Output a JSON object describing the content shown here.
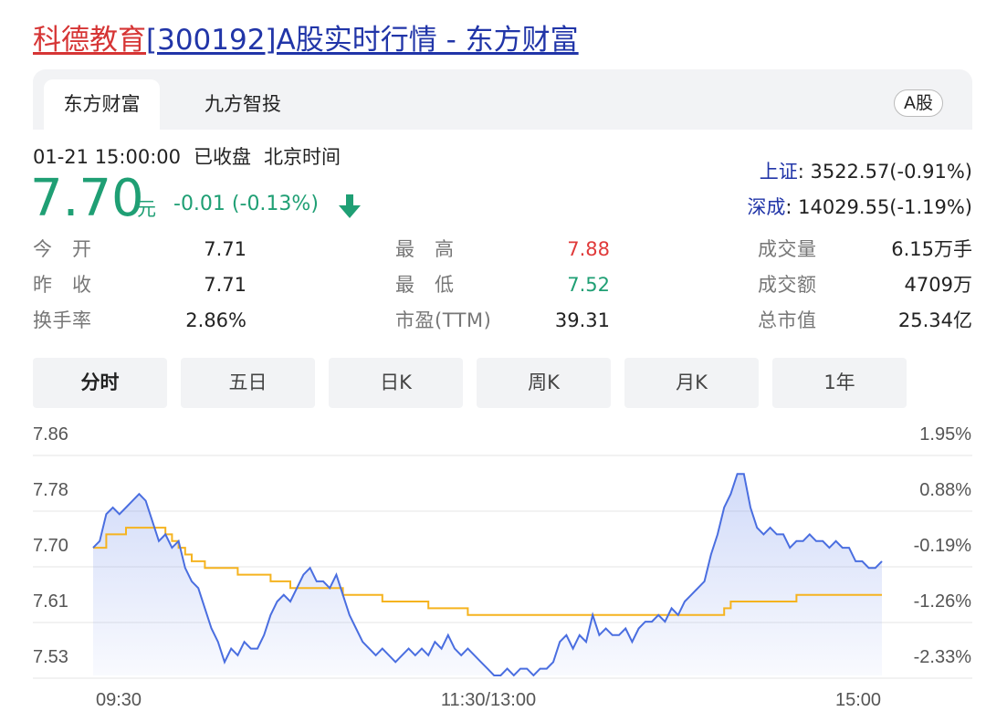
{
  "page": {
    "title_part1": "科德教育",
    "title_part2": "[300192]A股实时行情 - 东方财富"
  },
  "tabs": {
    "items": [
      {
        "label": "东方财富",
        "active": true
      },
      {
        "label": "九方智投",
        "active": false
      }
    ],
    "market_badge": "A股"
  },
  "quote": {
    "datetime": "01-21 15:00:00",
    "status": "已收盘",
    "timezone": "北京时间",
    "price": "7.70",
    "price_unit": "元",
    "change": "-0.01 (-0.13%)",
    "direction_icon": "arrow-down-icon",
    "down_color": "#1f9f74",
    "up_color": "#e03a3a"
  },
  "indices": [
    {
      "name": "上证",
      "value": ": 3522.57(-0.91%)"
    },
    {
      "name": "深成",
      "value": ": 14029.55(-1.19%)"
    }
  ],
  "stats": [
    {
      "label": "今　开",
      "value": "7.71"
    },
    {
      "label": "昨　收",
      "value": "7.71"
    },
    {
      "label": "换手率",
      "value": "2.86%"
    },
    {
      "label": "最　高",
      "value": "7.88"
    },
    {
      "label": "最　低",
      "value": "7.52"
    },
    {
      "label": "市盈(TTM)",
      "value": "39.31"
    },
    {
      "label": "成交量",
      "value": "6.15万手"
    },
    {
      "label": "成交额",
      "value": "4709万"
    },
    {
      "label": "总市值",
      "value": "25.34亿"
    }
  ],
  "periods": [
    {
      "label": "分时",
      "active": true
    },
    {
      "label": "五日",
      "active": false
    },
    {
      "label": "日K",
      "active": false
    },
    {
      "label": "周K",
      "active": false
    },
    {
      "label": "月K",
      "active": false
    },
    {
      "label": "1年",
      "active": false
    }
  ],
  "chart_data": {
    "type": "line",
    "title": "",
    "y_ticks_left": [
      "7.86",
      "7.78",
      "7.70",
      "7.61",
      "7.53"
    ],
    "y_ticks_right": [
      "1.95%",
      "0.88%",
      "-0.19%",
      "-1.26%",
      "-2.33%"
    ],
    "x_ticks": [
      "09:30",
      "11:30/13:00",
      "15:00"
    ],
    "ylim": [
      7.51,
      7.87
    ],
    "x_range_minutes": [
      0,
      240
    ],
    "prev_close": 7.71,
    "series": [
      {
        "role": "price",
        "color": "#4a6ee0",
        "points": [
          [
            0,
            7.7
          ],
          [
            2,
            7.71
          ],
          [
            4,
            7.75
          ],
          [
            6,
            7.76
          ],
          [
            8,
            7.75
          ],
          [
            10,
            7.76
          ],
          [
            12,
            7.77
          ],
          [
            14,
            7.78
          ],
          [
            16,
            7.77
          ],
          [
            18,
            7.74
          ],
          [
            20,
            7.71
          ],
          [
            22,
            7.72
          ],
          [
            24,
            7.7
          ],
          [
            26,
            7.71
          ],
          [
            28,
            7.67
          ],
          [
            30,
            7.65
          ],
          [
            32,
            7.64
          ],
          [
            34,
            7.61
          ],
          [
            36,
            7.58
          ],
          [
            38,
            7.56
          ],
          [
            40,
            7.53
          ],
          [
            42,
            7.55
          ],
          [
            44,
            7.54
          ],
          [
            46,
            7.56
          ],
          [
            48,
            7.55
          ],
          [
            50,
            7.55
          ],
          [
            52,
            7.57
          ],
          [
            54,
            7.6
          ],
          [
            56,
            7.62
          ],
          [
            58,
            7.63
          ],
          [
            60,
            7.62
          ],
          [
            62,
            7.64
          ],
          [
            64,
            7.66
          ],
          [
            66,
            7.67
          ],
          [
            68,
            7.65
          ],
          [
            70,
            7.65
          ],
          [
            72,
            7.64
          ],
          [
            74,
            7.66
          ],
          [
            76,
            7.63
          ],
          [
            78,
            7.6
          ],
          [
            80,
            7.58
          ],
          [
            82,
            7.56
          ],
          [
            84,
            7.55
          ],
          [
            86,
            7.54
          ],
          [
            88,
            7.55
          ],
          [
            90,
            7.54
          ],
          [
            92,
            7.53
          ],
          [
            94,
            7.54
          ],
          [
            96,
            7.55
          ],
          [
            98,
            7.54
          ],
          [
            100,
            7.55
          ],
          [
            102,
            7.54
          ],
          [
            104,
            7.56
          ],
          [
            106,
            7.55
          ],
          [
            108,
            7.57
          ],
          [
            110,
            7.55
          ],
          [
            112,
            7.54
          ],
          [
            114,
            7.55
          ],
          [
            116,
            7.54
          ],
          [
            118,
            7.53
          ],
          [
            120,
            7.52
          ],
          [
            122,
            7.51
          ],
          [
            124,
            7.51
          ],
          [
            126,
            7.52
          ],
          [
            128,
            7.51
          ],
          [
            130,
            7.52
          ],
          [
            132,
            7.52
          ],
          [
            134,
            7.51
          ],
          [
            136,
            7.52
          ],
          [
            138,
            7.52
          ],
          [
            140,
            7.53
          ],
          [
            142,
            7.56
          ],
          [
            144,
            7.57
          ],
          [
            146,
            7.55
          ],
          [
            148,
            7.57
          ],
          [
            150,
            7.56
          ],
          [
            152,
            7.6
          ],
          [
            154,
            7.57
          ],
          [
            156,
            7.58
          ],
          [
            158,
            7.57
          ],
          [
            160,
            7.57
          ],
          [
            162,
            7.58
          ],
          [
            164,
            7.56
          ],
          [
            166,
            7.58
          ],
          [
            168,
            7.59
          ],
          [
            170,
            7.59
          ],
          [
            172,
            7.6
          ],
          [
            174,
            7.59
          ],
          [
            176,
            7.61
          ],
          [
            178,
            7.6
          ],
          [
            180,
            7.62
          ],
          [
            182,
            7.63
          ],
          [
            184,
            7.64
          ],
          [
            186,
            7.65
          ],
          [
            188,
            7.69
          ],
          [
            190,
            7.72
          ],
          [
            192,
            7.76
          ],
          [
            194,
            7.78
          ],
          [
            196,
            7.81
          ],
          [
            198,
            7.81
          ],
          [
            200,
            7.76
          ],
          [
            202,
            7.73
          ],
          [
            204,
            7.72
          ],
          [
            206,
            7.73
          ],
          [
            208,
            7.72
          ],
          [
            210,
            7.72
          ],
          [
            212,
            7.7
          ],
          [
            214,
            7.71
          ],
          [
            216,
            7.71
          ],
          [
            218,
            7.72
          ],
          [
            220,
            7.71
          ],
          [
            222,
            7.71
          ],
          [
            224,
            7.7
          ],
          [
            226,
            7.71
          ],
          [
            228,
            7.7
          ],
          [
            230,
            7.7
          ],
          [
            232,
            7.68
          ],
          [
            234,
            7.68
          ],
          [
            236,
            7.67
          ],
          [
            238,
            7.67
          ],
          [
            240,
            7.68
          ]
        ]
      },
      {
        "role": "average",
        "color": "#f5b31f",
        "points": [
          [
            0,
            7.7
          ],
          [
            4,
            7.72
          ],
          [
            6,
            7.72
          ],
          [
            10,
            7.73
          ],
          [
            16,
            7.73
          ],
          [
            20,
            7.73
          ],
          [
            22,
            7.72
          ],
          [
            24,
            7.71
          ],
          [
            26,
            7.7
          ],
          [
            28,
            7.69
          ],
          [
            30,
            7.68
          ],
          [
            32,
            7.68
          ],
          [
            34,
            7.67
          ],
          [
            40,
            7.67
          ],
          [
            44,
            7.66
          ],
          [
            48,
            7.66
          ],
          [
            52,
            7.66
          ],
          [
            54,
            7.65
          ],
          [
            56,
            7.65
          ],
          [
            58,
            7.65
          ],
          [
            60,
            7.64
          ],
          [
            64,
            7.64
          ],
          [
            72,
            7.64
          ],
          [
            74,
            7.64
          ],
          [
            76,
            7.63
          ],
          [
            78,
            7.63
          ],
          [
            84,
            7.63
          ],
          [
            86,
            7.63
          ],
          [
            88,
            7.62
          ],
          [
            92,
            7.62
          ],
          [
            94,
            7.62
          ],
          [
            96,
            7.62
          ],
          [
            98,
            7.62
          ],
          [
            100,
            7.62
          ],
          [
            102,
            7.61
          ],
          [
            106,
            7.61
          ],
          [
            110,
            7.61
          ],
          [
            112,
            7.61
          ],
          [
            114,
            7.6
          ],
          [
            118,
            7.6
          ],
          [
            122,
            7.6
          ],
          [
            126,
            7.6
          ],
          [
            130,
            7.6
          ],
          [
            134,
            7.6
          ],
          [
            138,
            7.6
          ],
          [
            142,
            7.6
          ],
          [
            146,
            7.6
          ],
          [
            150,
            7.6
          ],
          [
            154,
            7.6
          ],
          [
            160,
            7.6
          ],
          [
            164,
            7.6
          ],
          [
            166,
            7.6
          ],
          [
            170,
            7.6
          ],
          [
            174,
            7.6
          ],
          [
            178,
            7.6
          ],
          [
            182,
            7.6
          ],
          [
            186,
            7.6
          ],
          [
            188,
            7.6
          ],
          [
            190,
            7.6
          ],
          [
            192,
            7.61
          ],
          [
            194,
            7.62
          ],
          [
            196,
            7.62
          ],
          [
            198,
            7.62
          ],
          [
            200,
            7.62
          ],
          [
            204,
            7.62
          ],
          [
            208,
            7.62
          ],
          [
            212,
            7.62
          ],
          [
            214,
            7.63
          ],
          [
            216,
            7.63
          ],
          [
            220,
            7.63
          ],
          [
            224,
            7.63
          ],
          [
            228,
            7.63
          ],
          [
            232,
            7.63
          ],
          [
            236,
            7.63
          ],
          [
            240,
            7.63
          ]
        ]
      }
    ]
  }
}
